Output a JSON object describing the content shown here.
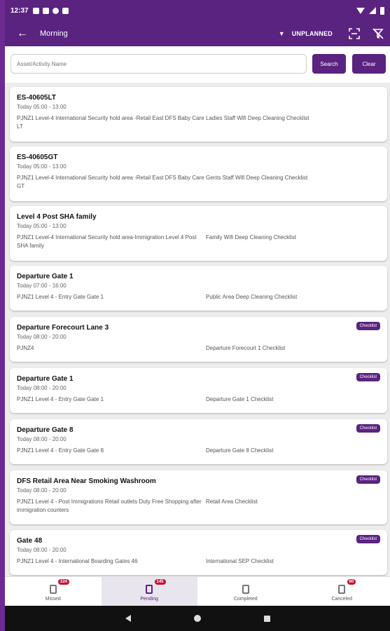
{
  "status_bar": {
    "time": "12:37"
  },
  "app_bar": {
    "title": "Morning",
    "mode_label": "UNPLANNED"
  },
  "search": {
    "placeholder": "Asset/Activity Name",
    "search_label": "Search",
    "clear_label": "Clear"
  },
  "cards": [
    {
      "title": "ES-40605LT",
      "time": "Today 05:00 - 13:00",
      "location": "PJNZ1 Level-4 International Security hold area -Retail East DFS Baby Care LT",
      "checklist": "Ladies Staff Wifi Deep Cleaning Checklist",
      "badge": ""
    },
    {
      "title": "ES-40605GT",
      "time": "Today 05:00 - 13:00",
      "location": "PJNZ1 Level-4 International Security hold area -Retail East DFS Baby Care GT",
      "checklist": "Gents Staff Wifi Deep Cleaning Checklist",
      "badge": ""
    },
    {
      "title": "Level 4 Post SHA family",
      "time": "Today 05:00 - 13:00",
      "location": "PJNZ1 Level-4 International Security hold area-Immigration Level 4 Post SHA family",
      "checklist": "Family Wifi Deep Cleaning Checklist",
      "badge": ""
    },
    {
      "title": "Departure Gate 1",
      "time": "Today 07:00 - 16:00",
      "location": "PJNZ1 Level 4 - Entry Gate Gate 1",
      "checklist": "Public Area Deep Cleaning Checklist",
      "badge": ""
    },
    {
      "title": "Departure Forecourt Lane 3",
      "time": "Today 08:00 - 20:00",
      "location": "PJNZ4",
      "checklist": "Departure Forecourt 1 Checklist",
      "badge": "Checklist"
    },
    {
      "title": "Departure Gate 1",
      "time": "Today 08:00 - 20:00",
      "location": "PJNZ1 Level 4 - Entry Gate Gate 1",
      "checklist": "Departure Gate 1 Checklist",
      "badge": "Checklist"
    },
    {
      "title": "Departure Gate 8",
      "time": "Today 08:00 - 20:00",
      "location": "PJNZ1 Level 4 - Entry Gate Gate 8",
      "checklist": "Departure Gate 8 Checklist",
      "badge": "Checklist"
    },
    {
      "title": "DFS Retail Area Near Smoking Washroom",
      "time": "Today 08:00 - 20:00",
      "location": "PJNZ1 Level 4 - Post Immigrations Retail outlets Duty Free Shopping after immigration counters",
      "checklist": "Retail Area Checklist",
      "badge": "Checklist"
    },
    {
      "title": "Gate 48",
      "time": "Today 08:00 - 20:00",
      "location": "PJNZ1 Level 4 - International Boarding Gates 46",
      "checklist": "International SEP Checklist",
      "badge": "Checklist"
    }
  ],
  "bottom_nav": [
    {
      "label": "Missed",
      "count": "224"
    },
    {
      "label": "Pending",
      "count": "145"
    },
    {
      "label": "Completed",
      "count": ""
    },
    {
      "label": "Canceled",
      "count": "60"
    }
  ]
}
